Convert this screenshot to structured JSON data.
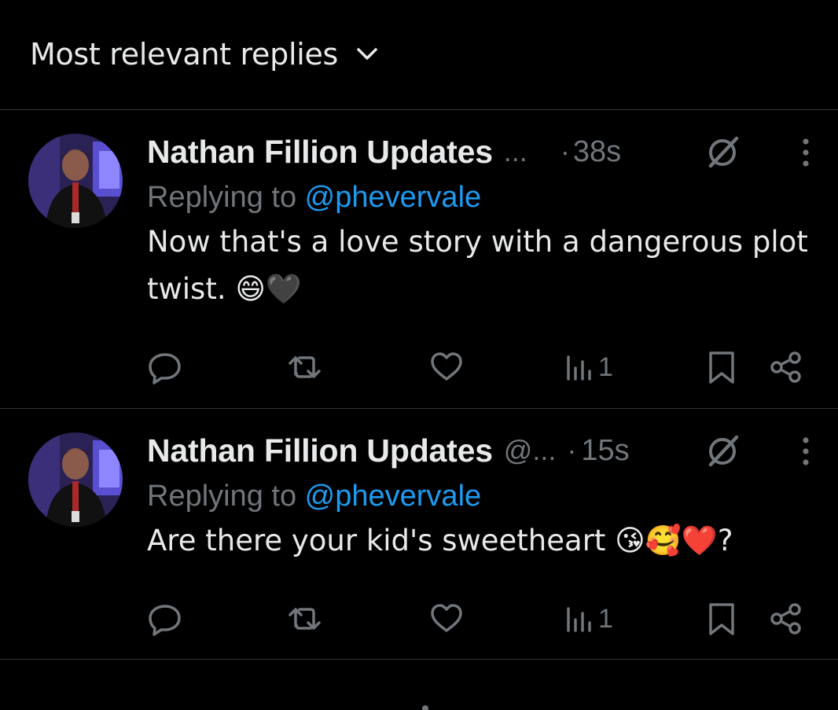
{
  "header": {
    "sort_label": "Most relevant replies"
  },
  "replies": [
    {
      "display_name": "Nathan Fillion Updates",
      "handle": "...",
      "dot": "·",
      "time": "38s",
      "replying_prefix": "Replying to ",
      "replying_to": "@phevervale",
      "text": "Now that's a love story with a dangerous plot twist. 😄🖤",
      "views": "1"
    },
    {
      "display_name": "Nathan Fillion Updates",
      "handle": "@...",
      "dot": "·",
      "time": "15s",
      "replying_prefix": "Replying to ",
      "replying_to": "@phevervale",
      "text": "Are there your kid's sweetheart 😘🥰❤️?",
      "views": "1"
    }
  ],
  "icons": [
    "chevron-down-icon",
    "avatar",
    "grok-icon",
    "more-icon",
    "reply-icon",
    "repost-icon",
    "like-icon",
    "views-icon",
    "bookmark-icon",
    "share-icon"
  ],
  "colors": {
    "background": "#000000",
    "text": "#e7e9ea",
    "secondary": "#71767b",
    "accent": "#1d9bf0",
    "divider": "#2f3336"
  }
}
